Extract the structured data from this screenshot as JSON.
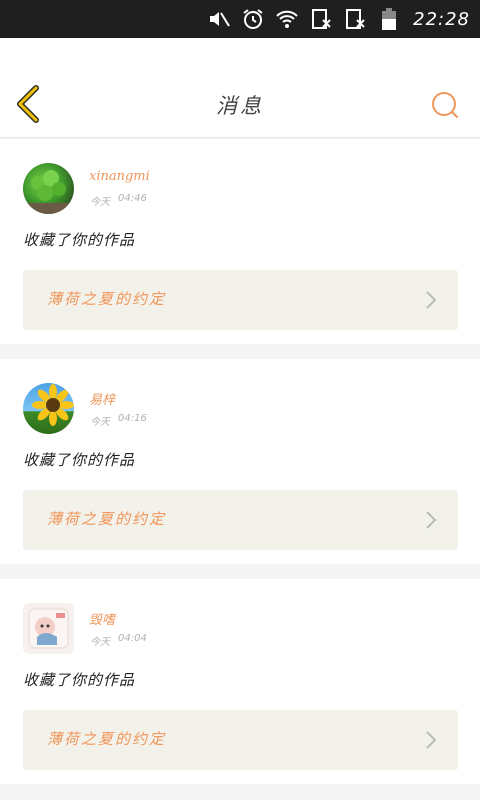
{
  "status_bar": {
    "time": "22:28",
    "icons": [
      "mute-icon",
      "alarm-icon",
      "wifi-icon",
      "no-sim-icon",
      "no-sim-icon",
      "battery-icon"
    ]
  },
  "header": {
    "title": "消息",
    "back_icon": "chevron-left-icon",
    "search_icon": "search-icon"
  },
  "colors": {
    "accent": "#f0955a",
    "back_icon": "#f2c200",
    "link_bg": "#f3f2ea"
  },
  "messages": [
    {
      "avatar": "clover-plant-avatar",
      "username": "xinangmi",
      "date": "今天",
      "time": "04:46",
      "action": "收藏了你的作品",
      "work_title": "薄荷之夏的约定"
    },
    {
      "avatar": "sunflower-avatar",
      "username": "易梓",
      "date": "今天",
      "time": "04:16",
      "action": "收藏了你的作品",
      "work_title": "薄荷之夏的约定"
    },
    {
      "avatar": "sticker-avatar",
      "username": "毁嗜",
      "date": "今天",
      "time": "04:04",
      "action": "收藏了你的作品",
      "work_title": "薄荷之夏的约定"
    }
  ]
}
